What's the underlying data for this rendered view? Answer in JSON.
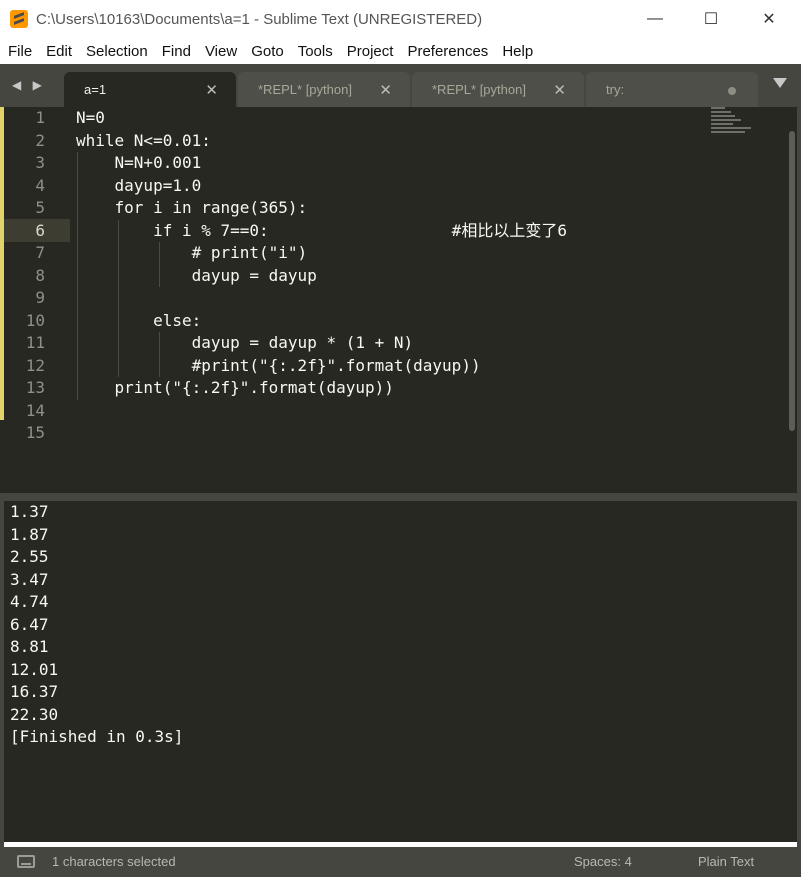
{
  "window": {
    "title": "C:\\Users\\10163\\Documents\\a=1 - Sublime Text (UNREGISTERED)",
    "minimize_icon": "minimize-icon",
    "maximize_icon": "maximize-icon",
    "close_icon": "close-icon",
    "minimize_glyph": "—",
    "maximize_glyph": "☐",
    "close_glyph": "✕"
  },
  "menu": [
    "File",
    "Edit",
    "Selection",
    "Find",
    "View",
    "Goto",
    "Tools",
    "Project",
    "Preferences",
    "Help"
  ],
  "tabs": [
    {
      "label": "a=1",
      "active": true,
      "close": "✕"
    },
    {
      "label": "*REPL* [python]",
      "active": false,
      "close": "✕"
    },
    {
      "label": "*REPL* [python]",
      "active": false,
      "close": "✕"
    },
    {
      "label": "try:",
      "active": false,
      "close": ""
    }
  ],
  "nav_arrows": "◀ ▶",
  "editor": {
    "line_numbers": [
      "1",
      "2",
      "3",
      "4",
      "5",
      "6",
      "7",
      "8",
      "9",
      "10",
      "11",
      "12",
      "13",
      "14",
      "15"
    ],
    "current_line": "6",
    "lines": [
      "N=0",
      "while N<=0.01:",
      "    N=N+0.001",
      "    dayup=1.0",
      "    for i in range(365):",
      "        if i % 7==0:                   #相比以上变了6",
      "            # print(\"i\")",
      "            dayup = dayup",
      "",
      "        else:",
      "            dayup = dayup * (1 + N)",
      "            #print(\"{:.2f}\".format(dayup))",
      "    print(\"{:.2f}\".format(dayup))",
      "",
      ""
    ]
  },
  "output": {
    "lines": [
      "1.37",
      "1.87",
      "2.55",
      "3.47",
      "4.74",
      "6.47",
      "8.81",
      "12.01",
      "16.37",
      "22.30",
      "[Finished in 0.3s]"
    ]
  },
  "status": {
    "selection": "1 characters selected",
    "spaces": "Spaces: 4",
    "syntax": "Plain Text"
  },
  "colors": {
    "editor_bg": "#272822",
    "chrome_bg": "#45463f",
    "modified_marker": "#e2d26b"
  }
}
